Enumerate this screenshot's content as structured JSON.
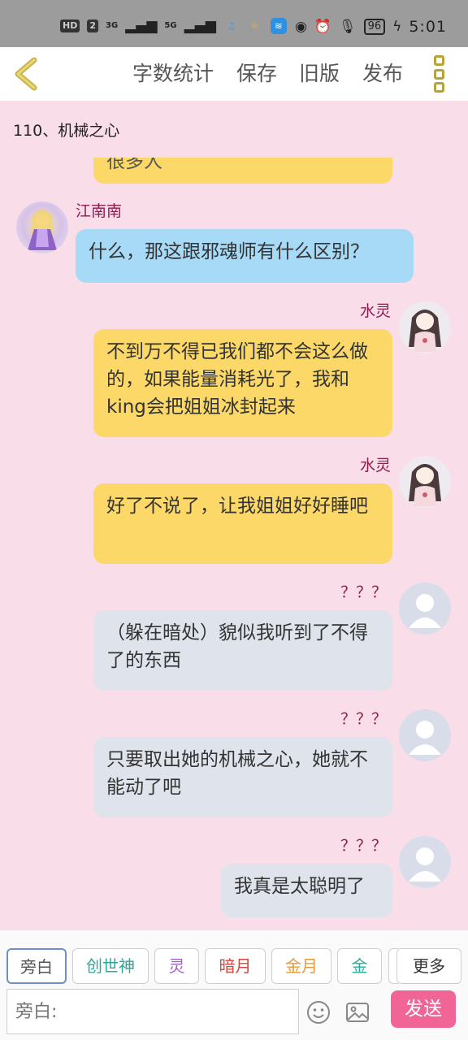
{
  "status_bar": {
    "network_badge": "HD",
    "sim": "2",
    "signal_1": "3G",
    "signal_2": "5G",
    "battery": "96",
    "time": "5:01"
  },
  "toolbar": {
    "back_icon": "chevron-left-icon",
    "word_count_label": "字数统计",
    "save_label": "保存",
    "old_version_label": "旧版",
    "publish_label": "发布",
    "menu_icon": "vertical-menu-icon"
  },
  "chapter_title": "110、机械之心",
  "messages": [
    {
      "speaker": "",
      "text": "很多人",
      "side": "right",
      "color": "#fbd867"
    },
    {
      "speaker": "江南南",
      "text": "什么，那这跟邪魂师有什么区别？",
      "side": "left",
      "color": "#a7daf6"
    },
    {
      "speaker": "水灵",
      "text": "不到万不得已我们都不会这么做的，如果能量消耗光了，我和king会把姐姐冰封起来",
      "side": "right",
      "color": "#fbd867"
    },
    {
      "speaker": "水灵",
      "text": "好了不说了，让我姐姐好好睡吧",
      "side": "right",
      "color": "#fbd867"
    },
    {
      "speaker": "？？？",
      "text": "（躲在暗处）貌似我听到了不得了的东西",
      "side": "right",
      "color": "#dee3ec"
    },
    {
      "speaker": "？？？",
      "text": "只要取出她的机械之心，她就不能动了吧",
      "side": "right",
      "color": "#dee3ec"
    },
    {
      "speaker": "？？？",
      "text": "我真是太聪明了",
      "side": "right",
      "color": "#dee3ec"
    }
  ],
  "characters": [
    {
      "label": "旁白",
      "color": "#555555"
    },
    {
      "label": "创世神",
      "color": "#2aa89a"
    },
    {
      "label": "灵",
      "color": "#a35fc7"
    },
    {
      "label": "暗月",
      "color": "#d4463c"
    },
    {
      "label": "金月",
      "color": "#e59a3a"
    },
    {
      "label": "金",
      "color": "#2aa89a"
    }
  ],
  "more_label": "更多",
  "composer": {
    "placeholder": "旁白:",
    "emoji_icon": "smiley-icon",
    "image_icon": "image-icon",
    "send_label": "发送"
  }
}
